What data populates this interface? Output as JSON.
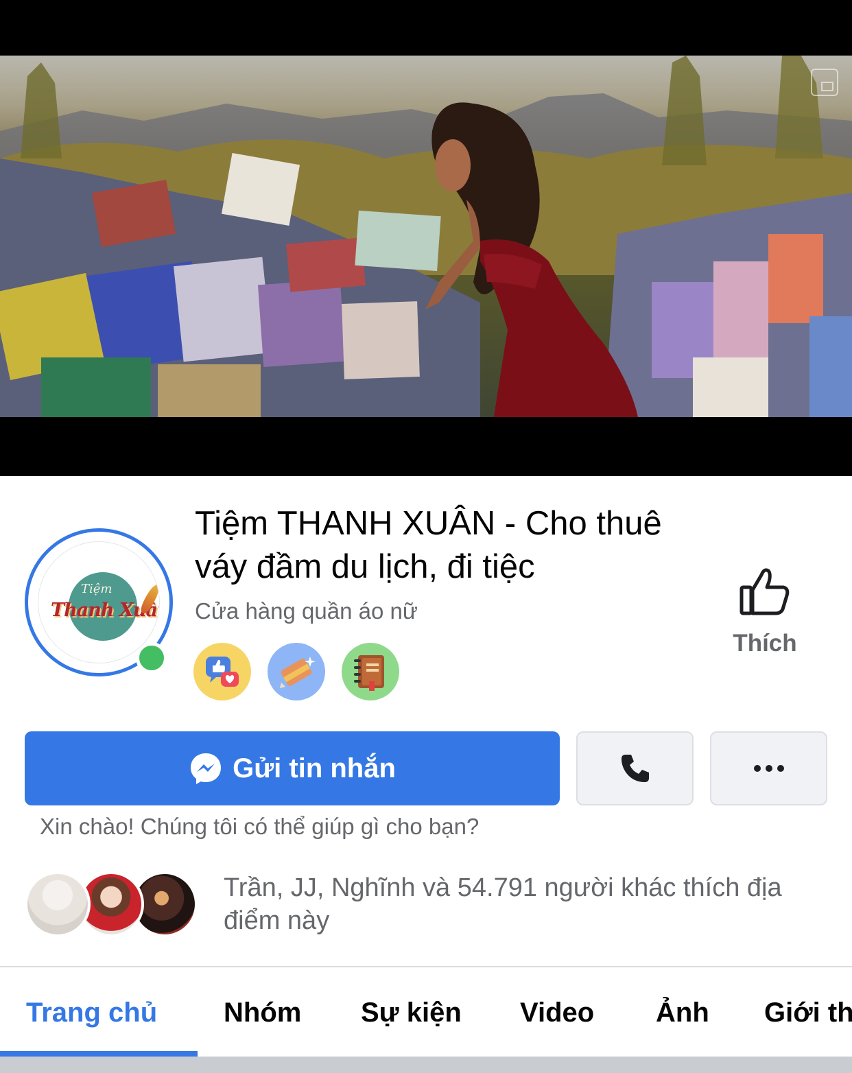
{
  "cover": {
    "type": "video"
  },
  "page": {
    "name": "Tiệm THANH XUÂN - Cho thuê váy đầm du lịch, đi tiệc",
    "category": "Cửa hàng quần áo nữ",
    "avatar_text_small": "Tiệm",
    "avatar_text_large": "Thanh Xuân",
    "online": true
  },
  "badges": [
    {
      "icon": "like-love-chat-icon",
      "color": "#f7d565"
    },
    {
      "icon": "paint-pencil-icon",
      "color": "#8eb5f5"
    },
    {
      "icon": "notebook-icon",
      "color": "#8fd98a"
    }
  ],
  "like_action": {
    "label": "Thích",
    "icon": "thumbs-up-icon"
  },
  "actions": {
    "message_label": "Gửi tin nhắn",
    "message_icon": "messenger-icon",
    "call_icon": "phone-icon",
    "more_icon": "more-icon",
    "accent": "#3578e5"
  },
  "greeting": "Xin chào! Chúng tôi có thể giúp gì cho bạn?",
  "social": {
    "likes_text": "Trần, JJ, Nghĩnh và 54.791 người khác thích địa điểm này",
    "friends": [
      "friend-1",
      "friend-2",
      "friend-3"
    ]
  },
  "tabs": [
    {
      "label": "Trang chủ",
      "active": true
    },
    {
      "label": "Nhóm",
      "active": false
    },
    {
      "label": "Sự kiện",
      "active": false
    },
    {
      "label": "Video",
      "active": false
    },
    {
      "label": "Ảnh",
      "active": false
    },
    {
      "label": "Giới thiệu",
      "active": false
    }
  ]
}
